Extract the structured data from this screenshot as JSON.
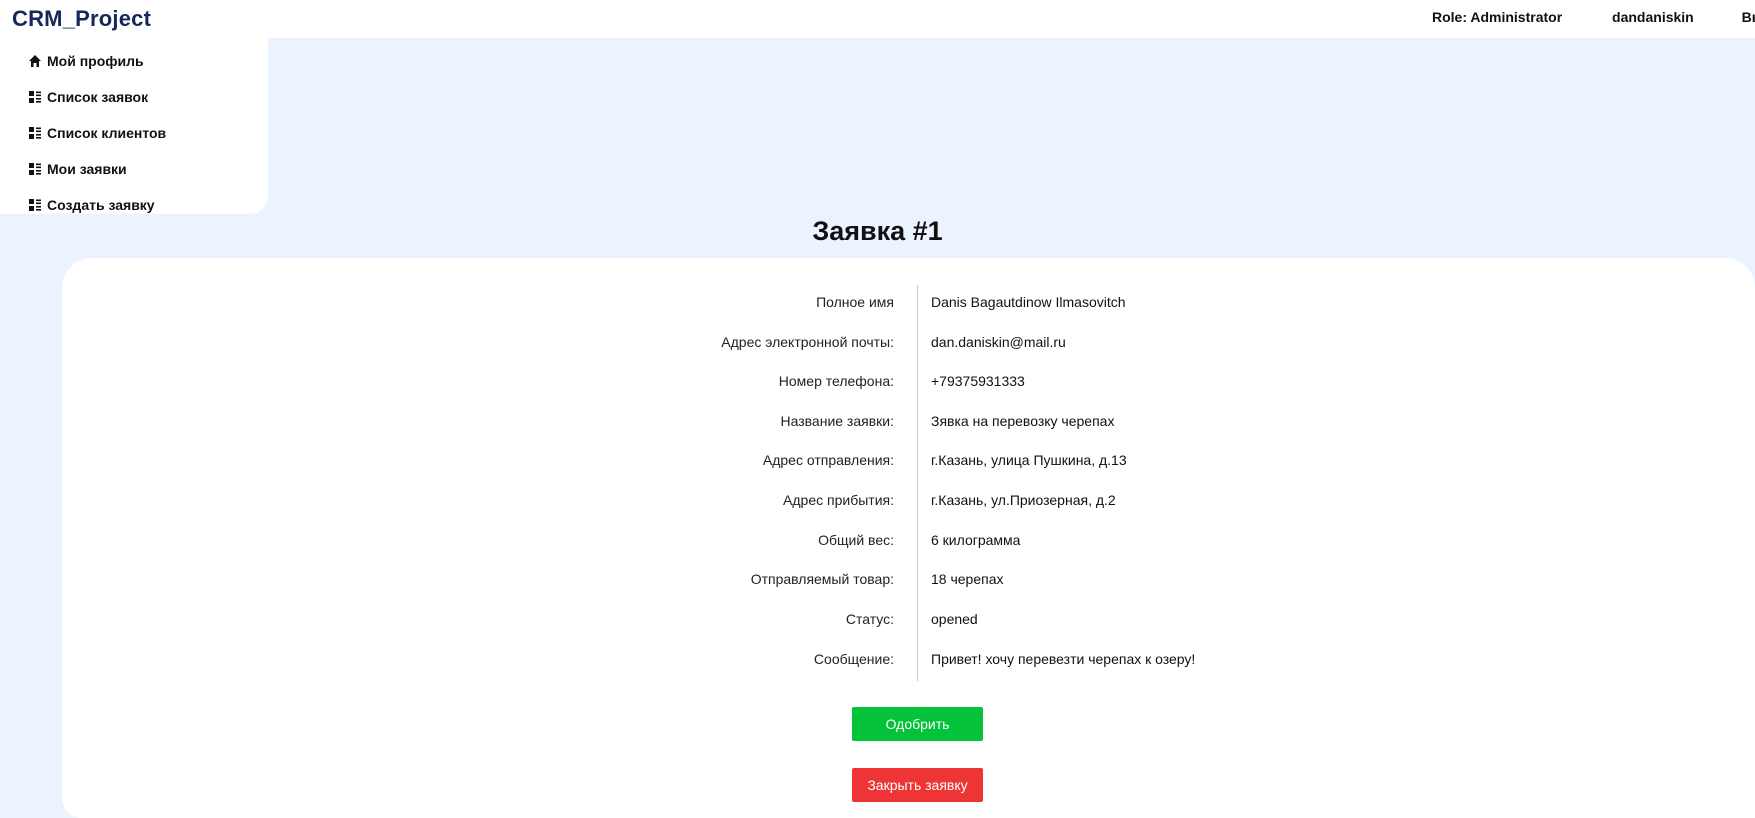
{
  "header": {
    "brand": "CRM_Project",
    "role": "Role: Administrator",
    "username": "dandaniskin",
    "logout": "Вы"
  },
  "sidebar": {
    "items": [
      {
        "label": "Мой профиль",
        "icon": "home-icon"
      },
      {
        "label": "Список заявок",
        "icon": "list-icon"
      },
      {
        "label": "Список клиентов",
        "icon": "list-icon"
      },
      {
        "label": "Мои заявки",
        "icon": "list-icon"
      },
      {
        "label": "Создать заявку",
        "icon": "list-icon"
      }
    ]
  },
  "request": {
    "title": "Заявка #1",
    "fields": [
      {
        "label": "Полное имя",
        "value": "Danis Bagautdinow Ilmasovitch"
      },
      {
        "label": "Адрес электронной почты:",
        "value": "dan.daniskin@mail.ru"
      },
      {
        "label": "Номер телефона:",
        "value": "+79375931333"
      },
      {
        "label": "Название заявки:",
        "value": "Зявка на перевозку черепах"
      },
      {
        "label": "Адрес отправления:",
        "value": "г.Казань, улица Пушкина, д.13"
      },
      {
        "label": "Адрес прибытия:",
        "value": "г.Казань, ул.Приозерная, д.2"
      },
      {
        "label": "Общий вес:",
        "value": "6 килограмма"
      },
      {
        "label": "Отправляемый товар:",
        "value": "18 черепах"
      },
      {
        "label": "Статус:",
        "value": "opened"
      },
      {
        "label": "Сообщение:",
        "value": "Привет! хочу перевезти черепах к озеру!"
      }
    ]
  },
  "actions": {
    "approve_label": "Одобрить",
    "close_label": "Закрыть заявку"
  },
  "colors": {
    "brand": "#14285a",
    "background": "#ebf3ff",
    "approve": "#04c23a",
    "close": "#ed3535"
  }
}
